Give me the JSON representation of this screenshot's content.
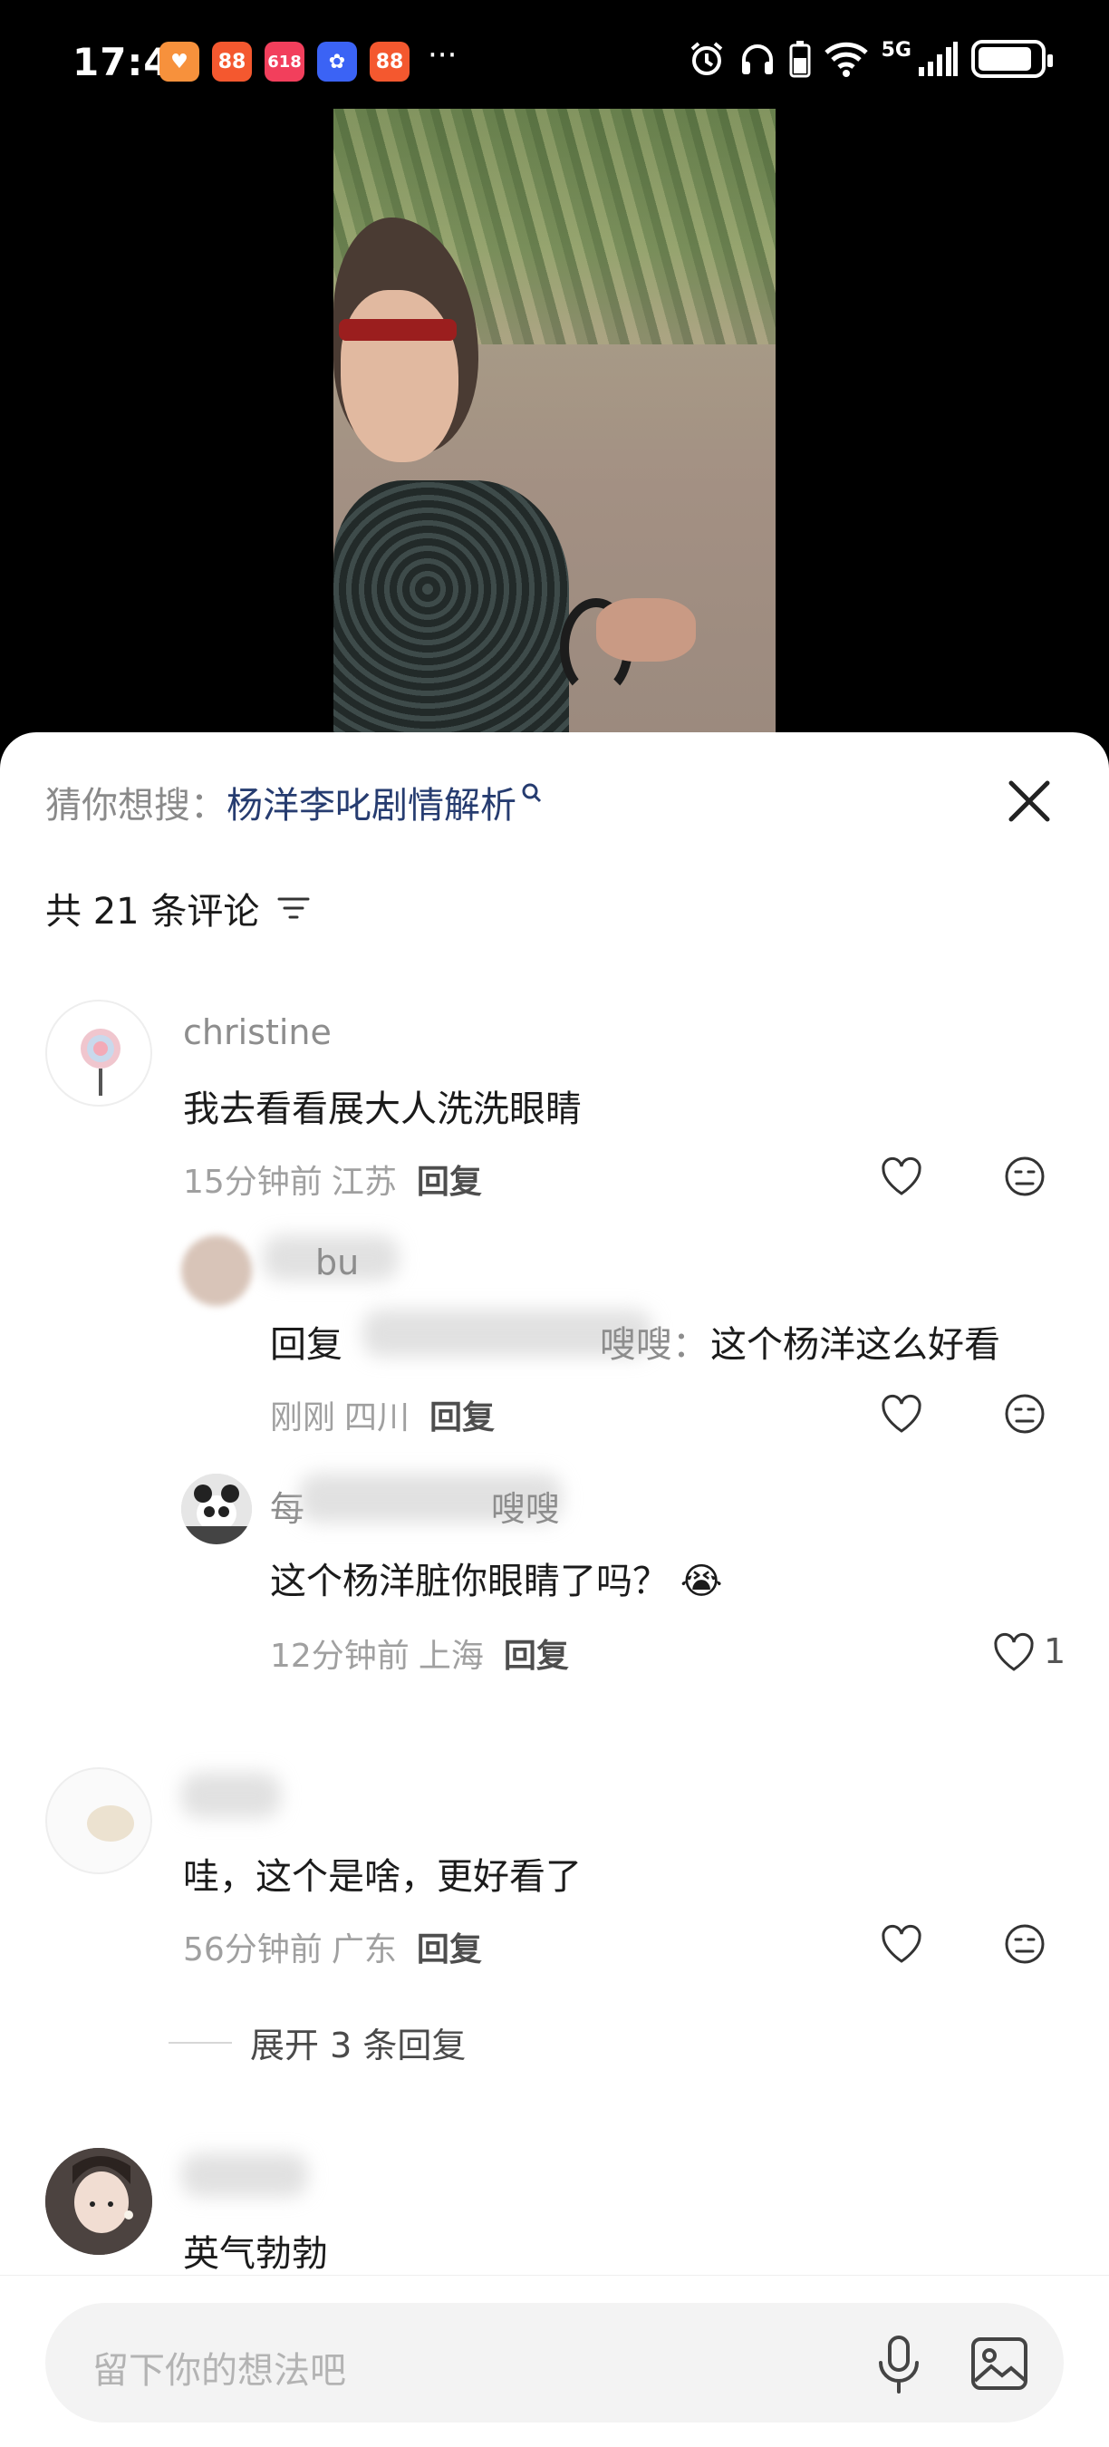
{
  "status_bar": {
    "time": "17:49",
    "notifications": [
      {
        "name": "app-icon-heart",
        "label": "♥",
        "color": "#f7913c"
      },
      {
        "name": "app-icon-1",
        "label": "88",
        "color": "#f4582f"
      },
      {
        "name": "app-icon-618",
        "label": "618",
        "color": "#f23f5c"
      },
      {
        "name": "app-icon-blue",
        "label": "✿",
        "color": "#3b63f5"
      },
      {
        "name": "app-icon-2",
        "label": "88",
        "color": "#f4582f"
      }
    ],
    "more": "···",
    "network": "5G"
  },
  "sheet": {
    "search_prefix": "猜你想搜：",
    "search_term": "杨洋李叱剧情解析",
    "comment_count_label": "共 21 条评论"
  },
  "comments": [
    {
      "username": "christine",
      "text": "我去看看展大人洗洗眼睛",
      "time": "15分钟前",
      "location": "江苏",
      "reply_label": "回复"
    },
    {
      "username": "bu",
      "reply_prefix": "回复",
      "reply_target_suffix": "嗖嗖：",
      "text": "这个杨洋这么好看",
      "time": "刚刚",
      "location": "四川",
      "reply_label": "回复"
    },
    {
      "username": "每",
      "username_tail": "嗖嗖",
      "text": "这个杨洋脏你眼睛了吗？",
      "emoji": "😭",
      "time": "12分钟前",
      "location": "上海",
      "reply_label": "回复",
      "likes": "1"
    },
    {
      "text": "哇，这个是啥，更好看了",
      "time": "56分钟前",
      "location": "广东",
      "reply_label": "回复"
    },
    {
      "text": "英气勃勃"
    }
  ],
  "expand_replies": "展开 3 条回复",
  "input": {
    "placeholder": "留下你的想法吧"
  }
}
